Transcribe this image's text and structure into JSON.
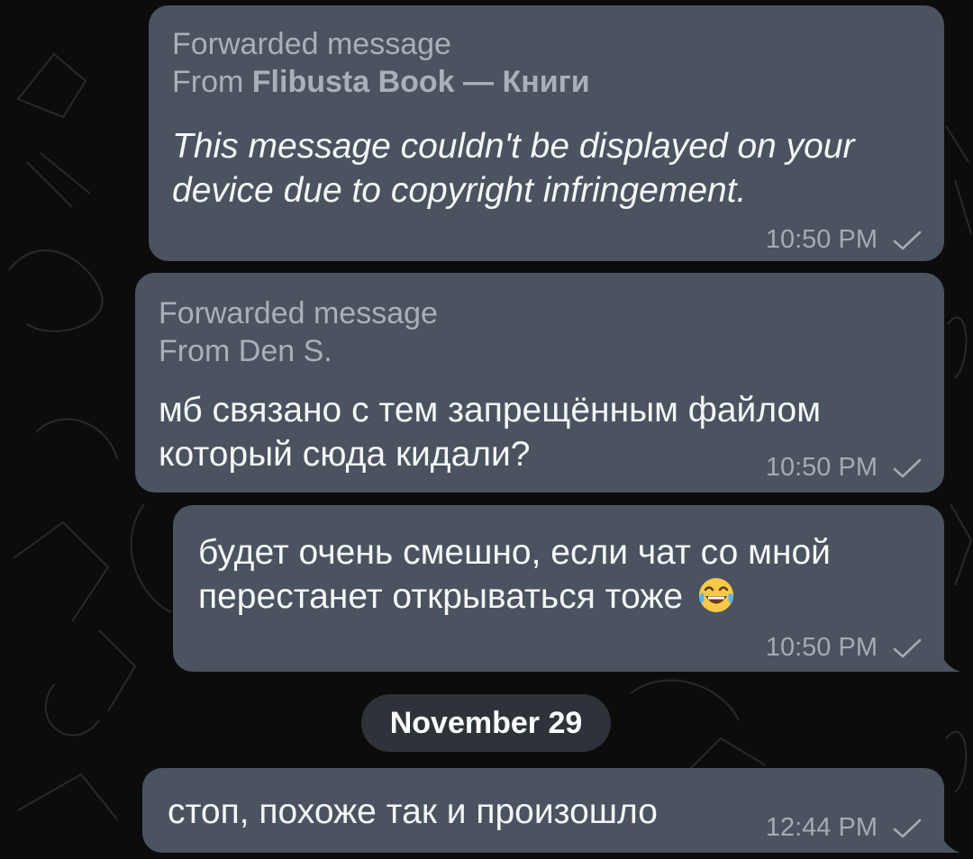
{
  "messages": [
    {
      "forward_title": "Forwarded message",
      "forward_from_prefix": "From ",
      "forward_from_name": "Flibusta Book — Книги",
      "text_line1": "This message couldn't be displayed on your",
      "text_line2": "device due to copyright infringement.",
      "time": "10:50 PM"
    },
    {
      "forward_title": "Forwarded message",
      "forward_from": "From Den S.",
      "text_line1": "мб связано с тем запрещённым файлом",
      "text_line2": "который сюда кидали?",
      "time": "10:50 PM"
    },
    {
      "text_line1": "будет очень смешно, если чат со мной",
      "text_line2": "перестанет открываться тоже",
      "emoji": "tears-of-joy-emoji",
      "time": "10:50 PM"
    },
    {
      "text": "стоп, похоже так и произошло",
      "time": "12:44 PM"
    }
  ],
  "date_separator": "November 29",
  "colors": {
    "background": "#0c0c0d",
    "bubble": "#4a535f",
    "forward_text": "#a8b0ba",
    "message_text": "#f4f6f8",
    "date_chip": "#2e3339"
  }
}
